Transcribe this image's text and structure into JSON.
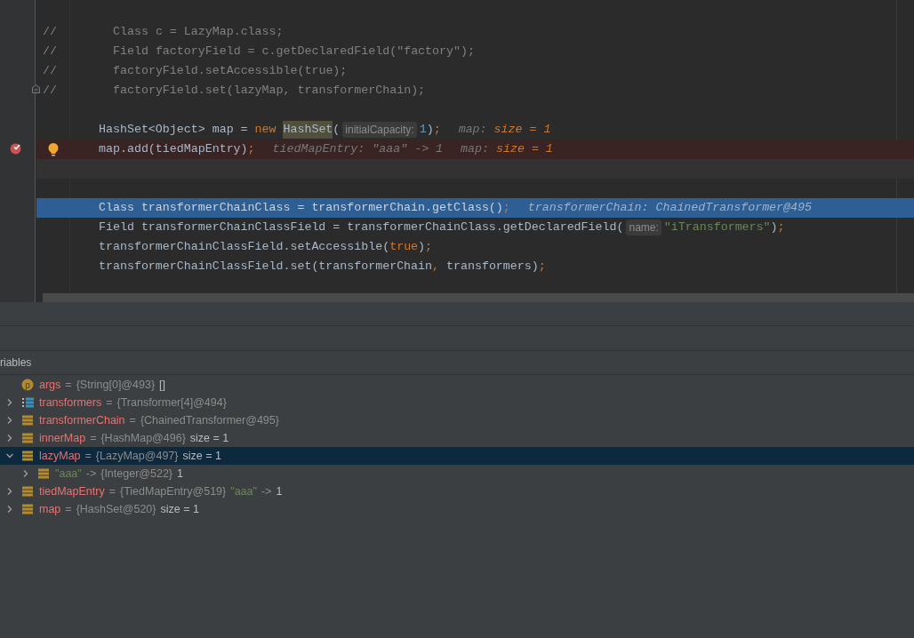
{
  "editor": {
    "lines": [
      {
        "kind": "blank"
      },
      {
        "kind": "comment",
        "marker": "//",
        "tokens": [
          {
            "text": "Class c = LazyMap.class;",
            "kind": "comment"
          }
        ]
      },
      {
        "kind": "comment",
        "marker": "//",
        "tokens": [
          {
            "text": "Field factoryField = c.getDeclaredField(\"factory\");",
            "kind": "comment"
          }
        ]
      },
      {
        "kind": "comment",
        "marker": "//",
        "tokens": [
          {
            "text": "factoryField.setAccessible(true);",
            "kind": "comment"
          }
        ]
      },
      {
        "kind": "comment",
        "marker": "//",
        "fold": true,
        "tokens": [
          {
            "text": "factoryField.set(lazyMap, transformerChain);",
            "kind": "comment"
          }
        ]
      },
      {
        "kind": "blank"
      },
      {
        "kind": "code",
        "tokens": [
          {
            "text": "HashSet<Object> map = ",
            "kind": "plain"
          },
          {
            "text": "new ",
            "kind": "keyword"
          },
          {
            "text": "HashSet",
            "kind": "highlight"
          },
          {
            "text": "(",
            "kind": "plain"
          },
          {
            "text": "initialCapacity:",
            "kind": "hint"
          },
          {
            "text": "1",
            "kind": "number"
          },
          {
            "text": ")",
            "kind": "plain"
          },
          {
            "text": ";",
            "kind": "punct"
          },
          {
            "text": "map: ",
            "kind": "inline"
          },
          {
            "text": "size = 1",
            "kind": "inlinevalue"
          }
        ]
      },
      {
        "kind": "breakpoint",
        "tokens": [
          {
            "text": "map.add(tiedMapEntry)",
            "kind": "plain"
          },
          {
            "text": ";",
            "kind": "punct"
          },
          {
            "text": "tiedMapEntry: \"aaa\" -> 1",
            "kind": "inline"
          },
          {
            "text": "map: ",
            "kind": "inline"
          },
          {
            "text": "size = 1",
            "kind": "inlinevalue"
          }
        ]
      },
      {
        "kind": "caret"
      },
      {
        "kind": "blank"
      },
      {
        "kind": "current",
        "tokens": [
          {
            "text": "Class transformerChainClass = transformerChain.getClass()",
            "kind": "plain"
          },
          {
            "text": ";",
            "kind": "punct"
          },
          {
            "text": "transformerChain: ChainedTransformer@495",
            "kind": "inline"
          }
        ]
      },
      {
        "kind": "code",
        "tokens": [
          {
            "text": "Field transformerChainClassField = transformerChainClass.getDeclaredField(",
            "kind": "plain"
          },
          {
            "text": "name:",
            "kind": "hint"
          },
          {
            "text": "\"iTransformers\"",
            "kind": "string"
          },
          {
            "text": ")",
            "kind": "plain"
          },
          {
            "text": ";",
            "kind": "punct"
          }
        ]
      },
      {
        "kind": "code",
        "tokens": [
          {
            "text": "transformerChainClassField.setAccessible(",
            "kind": "plain"
          },
          {
            "text": "true",
            "kind": "keyword"
          },
          {
            "text": ")",
            "kind": "plain"
          },
          {
            "text": ";",
            "kind": "punct"
          }
        ]
      },
      {
        "kind": "code",
        "tokens": [
          {
            "text": "transformerChainClassField.set(transformerChain",
            "kind": "plain"
          },
          {
            "text": ", ",
            "kind": "punct"
          },
          {
            "text": "transformers)",
            "kind": "plain"
          },
          {
            "text": ";",
            "kind": "punct"
          }
        ]
      },
      {
        "kind": "blank"
      }
    ]
  },
  "variables": {
    "title": "riables",
    "items": [
      {
        "kind": "param",
        "icon_text": "p",
        "name": "args",
        "sep": "=",
        "value": "{String[0]@493}",
        "extra": [
          {
            "text": "[]",
            "kind": "plain"
          }
        ],
        "selected": false
      },
      {
        "kind": "array",
        "name": "transformers",
        "sep": "=",
        "value": "{Transformer[4]@494}",
        "expanded": false,
        "selected": false
      },
      {
        "kind": "field",
        "name": "transformerChain",
        "sep": "=",
        "value": "{ChainedTransformer@495}",
        "expanded": false,
        "selected": false
      },
      {
        "kind": "field",
        "name": "innerMap",
        "sep": "=",
        "value": "{HashMap@496}",
        "extra": [
          {
            "text": "size = 1",
            "kind": "plain"
          }
        ],
        "expanded": false,
        "selected": false
      },
      {
        "kind": "field",
        "name": "lazyMap",
        "sep": "=",
        "value": "{LazyMap@497}",
        "extra": [
          {
            "text": "size = 1",
            "kind": "plain"
          }
        ],
        "expanded": true,
        "selected": true,
        "children": [
          {
            "kind": "entry",
            "name": "\"aaa\"",
            "sep": "->",
            "value": "{Integer@522}",
            "extra": [
              {
                "text": "1",
                "kind": "plain"
              }
            ],
            "expanded": false,
            "selected": false
          }
        ]
      },
      {
        "kind": "field",
        "name": "tiedMapEntry",
        "sep": "=",
        "value": "{TiedMapEntry@519}",
        "extra": [
          {
            "text": "\"aaa\"",
            "kind": "string"
          },
          {
            "text": "->",
            "kind": "dim"
          },
          {
            "text": "1",
            "kind": "plain"
          }
        ],
        "expanded": false,
        "selected": false
      },
      {
        "kind": "field",
        "name": "map",
        "sep": "=",
        "value": "{HashSet@520}",
        "extra": [
          {
            "text": "size = 1",
            "kind": "plain"
          }
        ],
        "expanded": false,
        "selected": false
      }
    ]
  }
}
